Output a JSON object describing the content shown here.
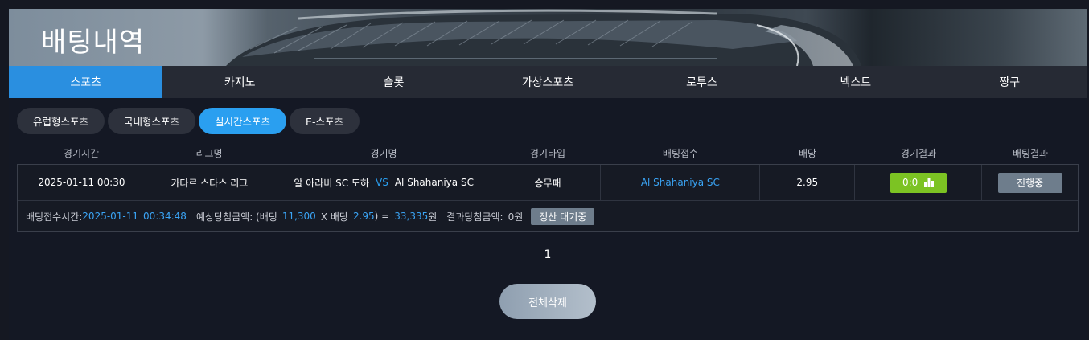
{
  "banner": {
    "title": "배팅내역"
  },
  "main_tabs": [
    "스포츠",
    "카지노",
    "슬롯",
    "가상스포츠",
    "로투스",
    "넥스트",
    "짱구"
  ],
  "sub_tabs": [
    "유럽형스포츠",
    "국내형스포츠",
    "실시간스포츠",
    "E-스포츠"
  ],
  "table": {
    "headers": [
      "경기시간",
      "리그명",
      "경기명",
      "경기타입",
      "배팅접수",
      "배당",
      "경기결과",
      "배팅결과"
    ]
  },
  "bet": {
    "time": "2025-01-11 00:30",
    "league": "카타르 스타스 리그",
    "home": "알 아라비 SC 도하",
    "vs": "VS",
    "away": "Al Shahaniya SC",
    "type": "승무패",
    "pick": "Al  Shahaniya  SC",
    "odds": "2.95",
    "score": "0:0",
    "status": "진행중"
  },
  "detail": {
    "received_label": "배팅접수시간:",
    "received_date": "2025-01-11",
    "received_time": "00:34:48",
    "expected_label": "예상당첨금액: (배팅",
    "stake": "11,300",
    "x_odds_label": "X 배당",
    "odds": "2.95",
    "equals": ") =",
    "payout": "33,335",
    "won_unit": "원",
    "result_label": "결과당첨금액:",
    "result_value": "0원",
    "pending": "정산 대기중"
  },
  "pagination": {
    "current": "1"
  },
  "actions": {
    "delete_all": "전체삭제"
  },
  "colors": {
    "accent_blue": "#2a8fe0",
    "score_green": "#7cc323",
    "status_gray": "#6e7d8c"
  }
}
